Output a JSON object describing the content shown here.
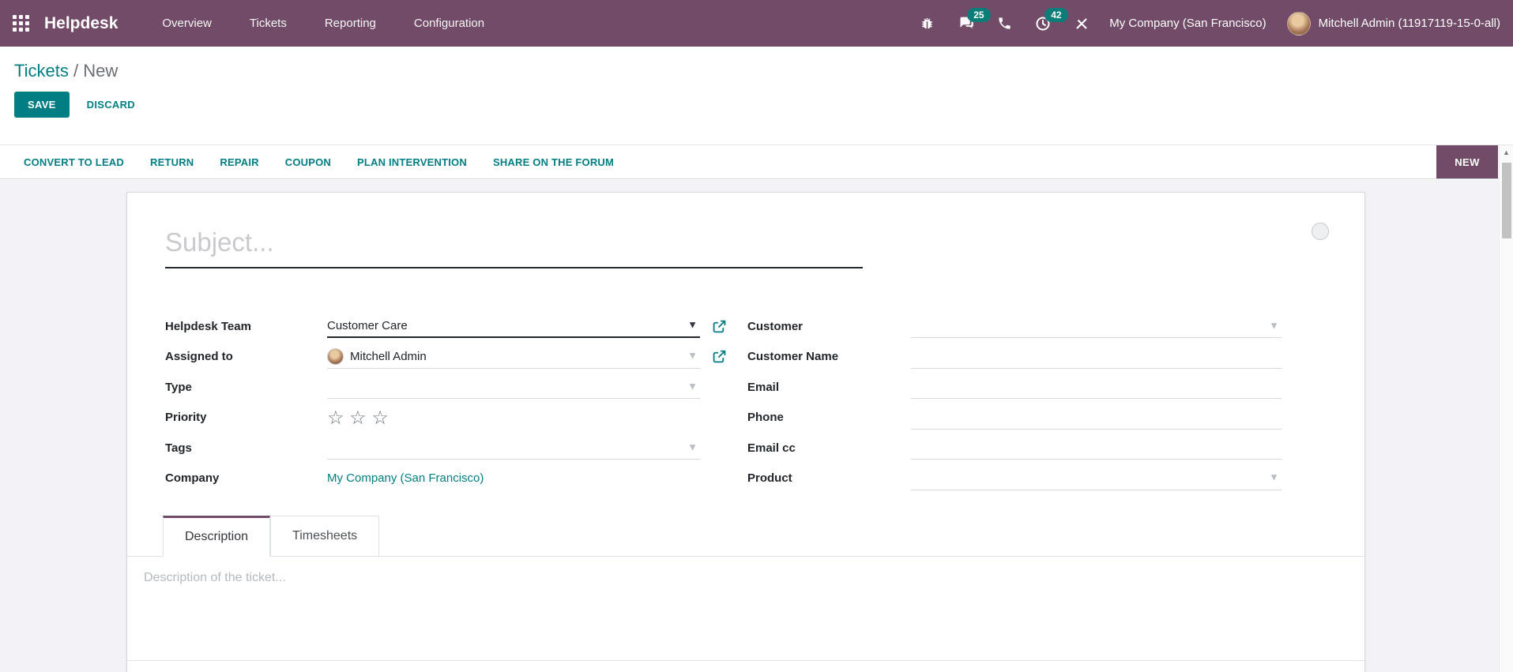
{
  "navbar": {
    "brand": "Helpdesk",
    "menus": [
      "Overview",
      "Tickets",
      "Reporting",
      "Configuration"
    ],
    "badges": {
      "messages": "25",
      "activities": "42"
    },
    "company": "My Company (San Francisco)",
    "user": "Mitchell Admin (11917119-15-0-all)"
  },
  "breadcrumb": {
    "parent": "Tickets",
    "separator": " / ",
    "current": "New"
  },
  "control": {
    "save": "SAVE",
    "discard": "DISCARD"
  },
  "action_bar": {
    "buttons": [
      "CONVERT TO LEAD",
      "RETURN",
      "REPAIR",
      "COUPON",
      "PLAN INTERVENTION",
      "SHARE ON THE FORUM"
    ],
    "stage": "NEW"
  },
  "form": {
    "subject_placeholder": "Subject...",
    "fields_left": [
      {
        "label": "Helpdesk Team",
        "value": "Customer Care"
      },
      {
        "label": "Assigned to",
        "value": "Mitchell Admin"
      },
      {
        "label": "Type",
        "value": ""
      },
      {
        "label": "Priority",
        "stars": 3,
        "star_glyph": "☆"
      },
      {
        "label": "Tags",
        "value": ""
      },
      {
        "label": "Company",
        "value": "My Company (San Francisco)"
      }
    ],
    "fields_right": [
      {
        "label": "Customer",
        "value": ""
      },
      {
        "label": "Customer Name",
        "value": ""
      },
      {
        "label": "Email",
        "value": ""
      },
      {
        "label": "Phone",
        "value": ""
      },
      {
        "label": "Email cc",
        "value": ""
      },
      {
        "label": "Product",
        "value": ""
      }
    ],
    "tabs": [
      {
        "label": "Description",
        "active": true
      },
      {
        "label": "Timesheets",
        "active": false
      }
    ],
    "description_placeholder": "Description of the ticket..."
  },
  "colors": {
    "navbar_bg": "#714B67",
    "primary_teal": "#017E84",
    "badge_teal": "#0C7D78",
    "stage_bg": "#714B67",
    "page_bg": "#f2f2f7"
  }
}
